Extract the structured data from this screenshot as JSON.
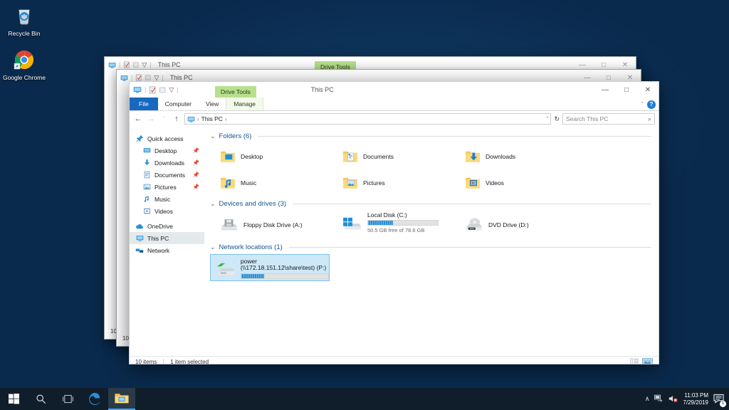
{
  "desktop": {
    "icons": [
      {
        "name": "Recycle Bin",
        "icon": "recycle-bin-icon"
      },
      {
        "name": "Google Chrome",
        "icon": "chrome-icon"
      }
    ]
  },
  "windows": {
    "back2": {
      "title": "This PC",
      "context_group": "Drive Tools",
      "status": "10"
    },
    "back1": {
      "title": "This PC",
      "context_group": "",
      "status": "10"
    },
    "front": {
      "title": "This PC",
      "context_group": "Drive Tools",
      "ribbon": {
        "file": "File",
        "tabs": [
          "Computer",
          "View"
        ],
        "contextual_tab": "Manage",
        "help_glyph": "?",
        "collapse_glyph": "ˇ"
      },
      "address": {
        "back_glyph": "←",
        "forward_glyph": "→",
        "recent_glyph": "ˇ",
        "up_glyph": "↑",
        "crumbs": [
          "This PC"
        ],
        "dropdown_glyph": "ˇ",
        "refresh_glyph": "↻"
      },
      "search": {
        "placeholder": "Search This PC",
        "icon": "search-icon"
      },
      "nav_pane": [
        {
          "label": "Quick access",
          "icon": "pin-icon",
          "indent": false,
          "pinned": false,
          "selected": false
        },
        {
          "label": "Desktop",
          "icon": "desktop-icon",
          "indent": true,
          "pinned": true,
          "selected": false
        },
        {
          "label": "Downloads",
          "icon": "downloads-icon",
          "indent": true,
          "pinned": true,
          "selected": false
        },
        {
          "label": "Documents",
          "icon": "documents-icon",
          "indent": true,
          "pinned": true,
          "selected": false
        },
        {
          "label": "Pictures",
          "icon": "pictures-icon",
          "indent": true,
          "pinned": true,
          "selected": false
        },
        {
          "label": "Music",
          "icon": "music-icon",
          "indent": true,
          "pinned": false,
          "selected": false
        },
        {
          "label": "Videos",
          "icon": "videos-icon",
          "indent": true,
          "pinned": false,
          "selected": false
        },
        {
          "label": "OneDrive",
          "icon": "onedrive-icon",
          "indent": false,
          "pinned": false,
          "selected": false
        },
        {
          "label": "This PC",
          "icon": "thispc-icon",
          "indent": false,
          "pinned": false,
          "selected": true
        },
        {
          "label": "Network",
          "icon": "network-icon",
          "indent": false,
          "pinned": false,
          "selected": false
        }
      ],
      "groups": {
        "folders": {
          "title": "Folders (6)",
          "items": [
            {
              "label": "Desktop",
              "icon": "folder-desktop-icon"
            },
            {
              "label": "Documents",
              "icon": "folder-documents-icon"
            },
            {
              "label": "Downloads",
              "icon": "folder-downloads-icon"
            },
            {
              "label": "Music",
              "icon": "folder-music-icon"
            },
            {
              "label": "Pictures",
              "icon": "folder-pictures-icon"
            },
            {
              "label": "Videos",
              "icon": "folder-videos-icon"
            }
          ]
        },
        "devices": {
          "title": "Devices and drives (3)",
          "items": [
            {
              "label": "Floppy Disk Drive (A:)",
              "icon": "floppy-drive-icon",
              "has_bar": false,
              "free": "",
              "fill_pct": 0
            },
            {
              "label": "Local Disk (C:)",
              "icon": "windows-drive-icon",
              "has_bar": true,
              "free": "50.5 GB free of 78.6 GB",
              "fill_pct": 36
            },
            {
              "label": "DVD Drive (D:)",
              "icon": "dvd-drive-icon",
              "has_bar": false,
              "free": "",
              "fill_pct": 0
            }
          ]
        },
        "network": {
          "title": "Network locations (1)",
          "items": [
            {
              "label": "power (\\\\172.18.151.12\\share\\test) (P:)",
              "icon": "network-drive-icon",
              "has_bar": true,
              "free": "",
              "fill_pct": 26,
              "selected": true
            }
          ]
        }
      },
      "statusbar": {
        "item_count": "10 items",
        "selection": "1 item selected",
        "views": [
          {
            "icon": "details-view-icon",
            "active": false
          },
          {
            "icon": "large-icons-view-icon",
            "active": true
          }
        ]
      }
    }
  },
  "taskbar": {
    "buttons": [
      {
        "icon": "start-icon",
        "active": false
      },
      {
        "icon": "search-icon",
        "active": false
      },
      {
        "icon": "task-view-icon",
        "active": false
      },
      {
        "icon": "edge-icon",
        "active": false
      },
      {
        "icon": "file-explorer-icon",
        "active": true
      }
    ],
    "tray": {
      "chevron_glyph": "∧",
      "network_icon": "network-tray-icon",
      "volume_icon": "volume-muted-icon",
      "time": "11:03 PM",
      "date": "7/29/2019",
      "action_center_icon": "action-center-icon",
      "notification_count": "1"
    }
  },
  "colors": {
    "accent": "#1668c1",
    "group_header": "#16558f",
    "context_tab": "#b7e08c",
    "selection": "#cde8f7",
    "taskbar": "#101e2c",
    "progress": "#2a8fd6"
  }
}
